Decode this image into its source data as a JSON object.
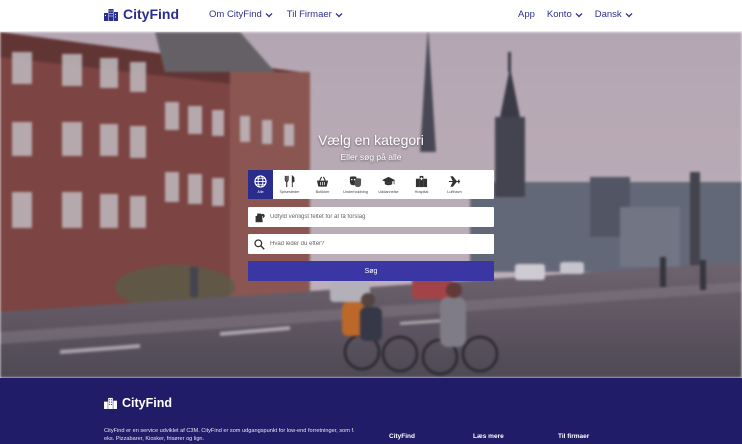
{
  "header": {
    "brand": "CityFind",
    "nav_left": [
      {
        "label": "Om CityFind"
      },
      {
        "label": "Til Firmaer"
      }
    ],
    "nav_right": [
      {
        "label": "App"
      },
      {
        "label": "Konto"
      },
      {
        "label": "Dansk"
      }
    ]
  },
  "hero": {
    "title": "Vælg en kategori",
    "subtitle": "Eller søg på alle",
    "categories": [
      {
        "label": "Alle",
        "icon": "globe-icon"
      },
      {
        "label": "Spisesteder",
        "icon": "fork-knife-icon"
      },
      {
        "label": "Butikker",
        "icon": "basket-icon"
      },
      {
        "label": "Underholdning",
        "icon": "theater-masks-icon"
      },
      {
        "label": "Uddannelse",
        "icon": "graduation-cap-icon"
      },
      {
        "label": "Hospital",
        "icon": "hospital-icon"
      },
      {
        "label": "Lufthavn",
        "icon": "airplane-icon"
      }
    ],
    "location_placeholder": "Udfyld venligst feltet for at få forslag",
    "search_placeholder": "Hvad leder du efter?",
    "search_button": "Søg"
  },
  "footer": {
    "brand": "CityFind",
    "description": "CityFind er en service udviklet af C3M. CityFind er som udgangspunkt for low-end forretninger, som f. eks. Pizzabarer, Kiosker, frisører og lign.",
    "columns": [
      {
        "title": "CityFind"
      },
      {
        "title": "Læs mere"
      },
      {
        "title": "Til firmaer"
      }
    ]
  },
  "colors": {
    "brand": "#2b2d8c",
    "button": "#3a37a5",
    "footer_bg": "#201c68"
  }
}
